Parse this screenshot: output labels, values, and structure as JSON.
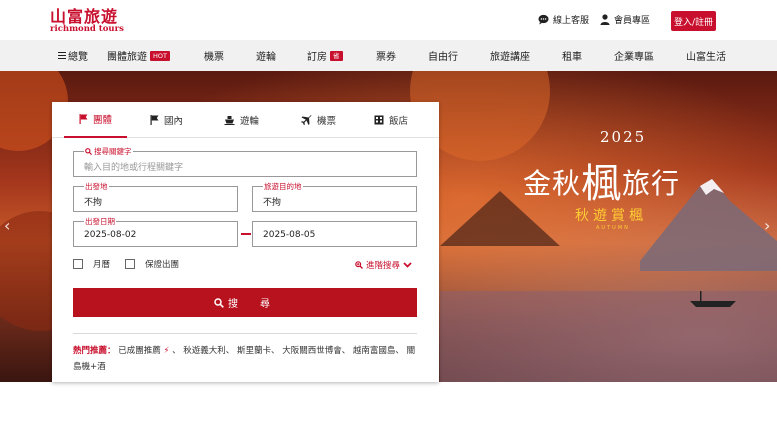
{
  "brand": {
    "name_zh": "山富旅遊",
    "name_en": "richmond tours"
  },
  "utility": {
    "chat_label": "線上客服",
    "member_label": "會員專區",
    "login_label": "登入/註冊"
  },
  "nav": {
    "menu_label": "總覽",
    "items": [
      {
        "label": "團體旅遊",
        "badge": "HOT"
      },
      {
        "label": "機票"
      },
      {
        "label": "遊輪"
      },
      {
        "label": "訂房",
        "badge": "省"
      },
      {
        "label": "票券"
      },
      {
        "label": "自由行"
      },
      {
        "label": "旅遊講座"
      },
      {
        "label": "租車"
      },
      {
        "label": "企業專區"
      },
      {
        "label": "山富生活"
      }
    ]
  },
  "hero": {
    "year": "2025",
    "title_a": "金秋",
    "title_big": "楓",
    "title_b": "旅行",
    "subtitle": "秋遊賞楓",
    "subtitle_en": "AUTUMN"
  },
  "search": {
    "tabs": [
      {
        "label": "團體",
        "icon": "flag-icon",
        "active": true
      },
      {
        "label": "國內",
        "icon": "flag-icon"
      },
      {
        "label": "遊輪",
        "icon": "ship-icon"
      },
      {
        "label": "機票",
        "icon": "plane-icon"
      },
      {
        "label": "飯店",
        "icon": "hotel-icon"
      }
    ],
    "keyword": {
      "label": "搜尋關鍵字",
      "placeholder": "輸入目的地或行程關鍵字"
    },
    "origin": {
      "label": "出發地",
      "value": "不拘"
    },
    "destination": {
      "label": "旅遊目的地",
      "value": "不拘"
    },
    "date": {
      "label": "出發日期",
      "from": "2025-08-02",
      "to": "2025-08-05"
    },
    "options": {
      "month_label": "月曆",
      "guaranteed_label": "保證出團",
      "advanced_label": "進階搜尋"
    },
    "button_label": "搜　尋"
  },
  "hot": {
    "label": "熱門推薦：",
    "first": "已成團推薦",
    "rest": "、 秋遊義大利、 斯里蘭卡、 大阪關西世博會、 越南富國島、 關島機+酒"
  },
  "colors": {
    "brand_red": "#c8102e",
    "nav_bg": "#f1f1f1"
  }
}
